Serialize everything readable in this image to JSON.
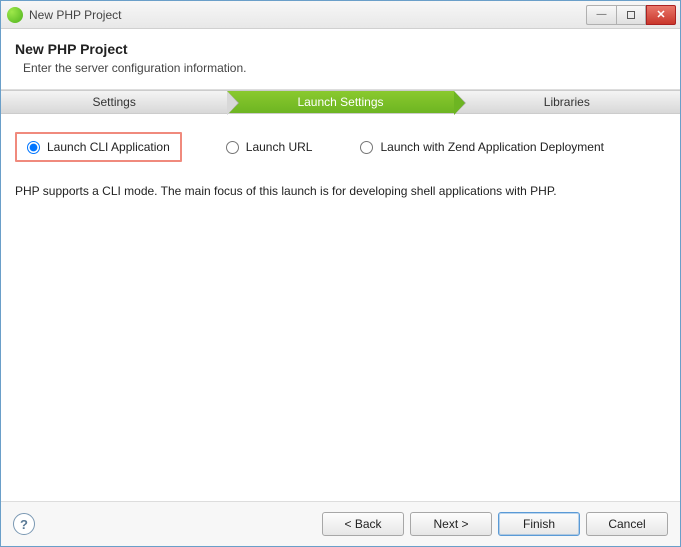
{
  "window": {
    "title": "New PHP Project"
  },
  "header": {
    "title": "New PHP Project",
    "subtitle": "Enter the server configuration information."
  },
  "steps": [
    {
      "label": "Settings",
      "active": false
    },
    {
      "label": "Launch Settings",
      "active": true
    },
    {
      "label": "Libraries",
      "active": false
    }
  ],
  "launch": {
    "options": {
      "cli": "Launch CLI Application",
      "url": "Launch URL",
      "zend": "Launch with Zend Application Deployment"
    },
    "selected": "cli",
    "description": "PHP supports a CLI mode. The main focus of this launch is for developing shell applications with PHP."
  },
  "buttons": {
    "back": "< Back",
    "next": "Next >",
    "finish": "Finish",
    "cancel": "Cancel"
  }
}
